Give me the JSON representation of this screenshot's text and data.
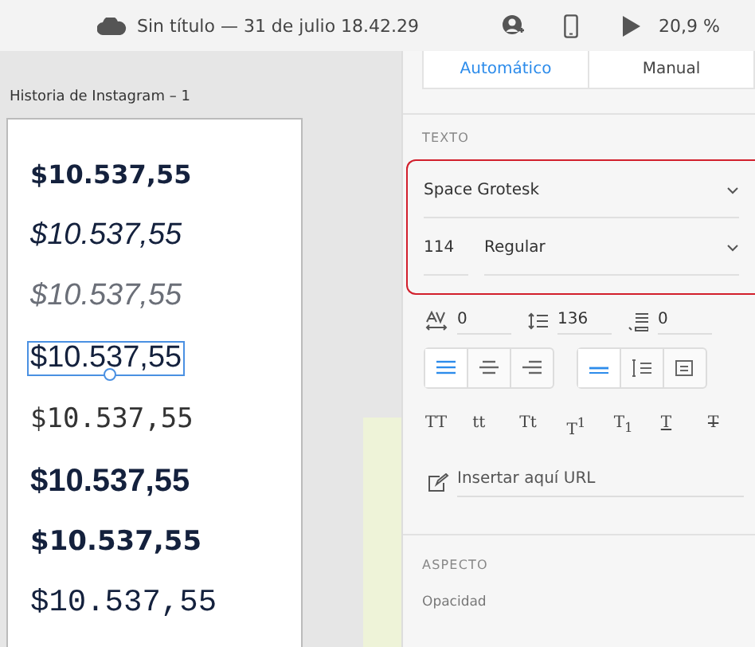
{
  "toolbar": {
    "document_title": "Sin título — 31 de julio 18.42.29",
    "zoom": "20,9 %"
  },
  "canvas": {
    "artboard_title": "Historia de Instagram – 1",
    "samples": [
      {
        "text": "$10.537,55",
        "kind": "bold-grotesk",
        "selected": false
      },
      {
        "text": "$10.537,55",
        "kind": "italic",
        "selected": false
      },
      {
        "text": "$10.537,55",
        "kind": "light-italic",
        "selected": false
      },
      {
        "text": "$10.537,55",
        "kind": "regular",
        "selected": true
      },
      {
        "text": "$10.537,55",
        "kind": "mono",
        "selected": false
      },
      {
        "text": "$10.537,55",
        "kind": "black",
        "selected": false
      },
      {
        "text": "$10.537,55",
        "kind": "heavy",
        "selected": false
      },
      {
        "text": "$10.537,55",
        "kind": "mono-medium",
        "selected": false
      }
    ]
  },
  "panel": {
    "tabs": [
      {
        "label": "Automático",
        "selected": true
      },
      {
        "label": "Manual",
        "selected": false
      }
    ],
    "text_section": {
      "title": "TEXTO",
      "font_family": "Space Grotesk",
      "font_size": "114",
      "font_style": "Regular",
      "character_spacing": "0",
      "line_spacing": "136",
      "paragraph_spacing": "0",
      "horizontal_align": [
        {
          "kind": "left",
          "selected": true
        },
        {
          "kind": "center",
          "selected": false
        },
        {
          "kind": "right",
          "selected": false
        }
      ],
      "text_box": [
        {
          "kind": "auto-width",
          "selected": true
        },
        {
          "kind": "auto-height",
          "selected": false
        },
        {
          "kind": "fixed",
          "selected": false
        }
      ],
      "transforms": [
        {
          "label": "TT",
          "kind": "plain"
        },
        {
          "label": "tt",
          "kind": "plain"
        },
        {
          "label": "Tt",
          "kind": "plain"
        },
        {
          "label": "T$^{1}$",
          "kind": "plain"
        },
        {
          "label": "T$_{1}$",
          "kind": "plain"
        },
        {
          "label": "T",
          "kind": "underline"
        },
        {
          "label": "T",
          "kind": "strike"
        }
      ],
      "url_placeholder": "Insertar aquí URL"
    },
    "appearance_section": {
      "title": "ASPECTO",
      "opacity_label": "Opacidad"
    }
  }
}
